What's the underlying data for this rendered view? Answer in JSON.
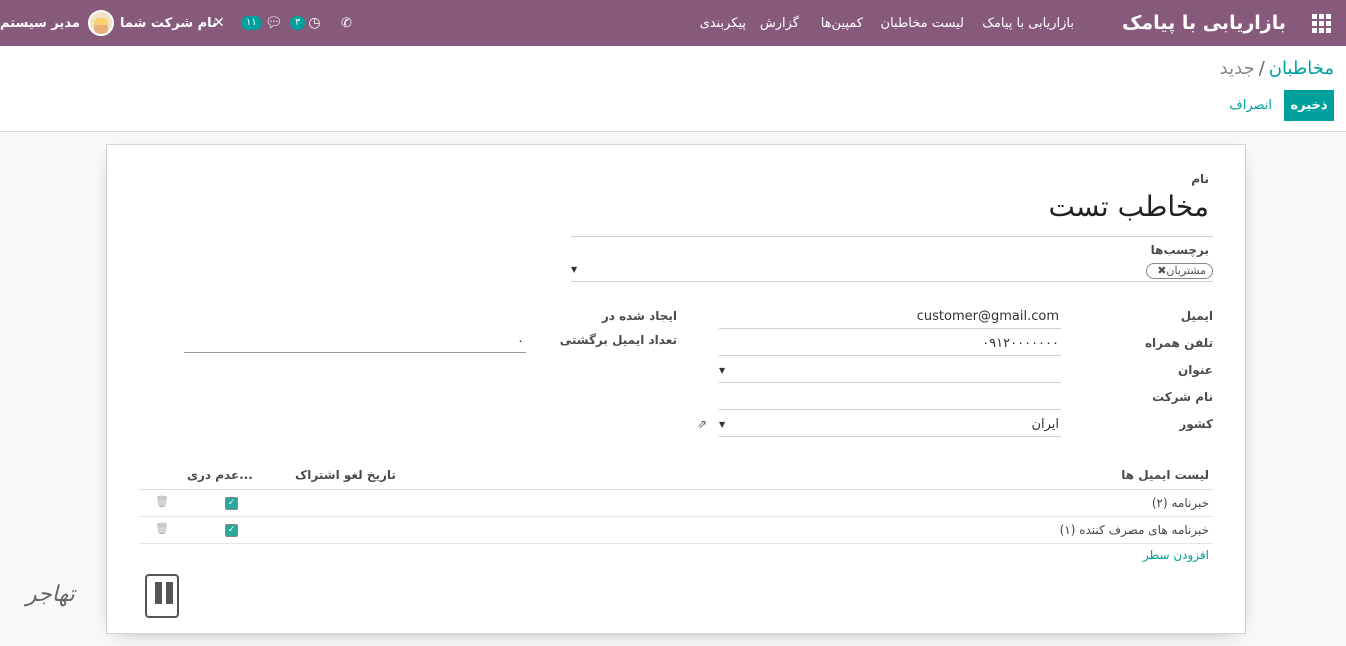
{
  "navbar": {
    "brand": "بازاریابی با پیامک",
    "menu": [
      "بازاریابی با پیامک",
      "لیست مخاطبان",
      "کمپین‌ها",
      "گزارش",
      "پیکربندی"
    ],
    "user_name": "مدیر سیستم",
    "company_name": "نام شرکت شما",
    "messages_count": "۱۱",
    "activities_count": "۳",
    "icons": [
      "apps-icon",
      "user-avatar",
      "tools-icon",
      "chat-icon",
      "clock-icon",
      "phone-icon"
    ]
  },
  "breadcrumb": {
    "parent": "مخاطبان",
    "separator": "/",
    "current": "جدید"
  },
  "buttons": {
    "save": "ذخیره",
    "discard": "انصراف"
  },
  "form": {
    "name_label": "نام",
    "name_value": "مخاطب تست",
    "tags_label": "برچسب‌ها",
    "tags": [
      "مشتریان"
    ],
    "email_label": "ایمیل",
    "email_value": "customer@gmail.com",
    "mobile_label": "تلفن همراه",
    "mobile_value": "۰۹۱۲۰۰۰۰۰۰۰",
    "title_label": "عنوان",
    "title_value": "",
    "company_label": "نام شرکت",
    "company_value": "",
    "country_label": "کشور",
    "country_value": "ایران",
    "created_label": "ایجاد شده در",
    "bounce_label": "تعداد ایمیل برگشتی",
    "bounce_value": "۰"
  },
  "mailing_lists": {
    "headers": {
      "list": "لیست ایمیل ها",
      "unsub_date": "تاریخ لغو اشتراک",
      "opt_out": "عدم دری..."
    },
    "rows": [
      {
        "name": "خبرنامه (۲)",
        "opt_out": true
      },
      {
        "name": "خبرنامه های مصرف کننده (۱)",
        "opt_out": true
      }
    ],
    "add_line": "افزودن سطر"
  },
  "watermark": {
    "text": "تهاجر"
  },
  "colors": {
    "navbar": "#875a7b",
    "accent": "#00a09d"
  }
}
